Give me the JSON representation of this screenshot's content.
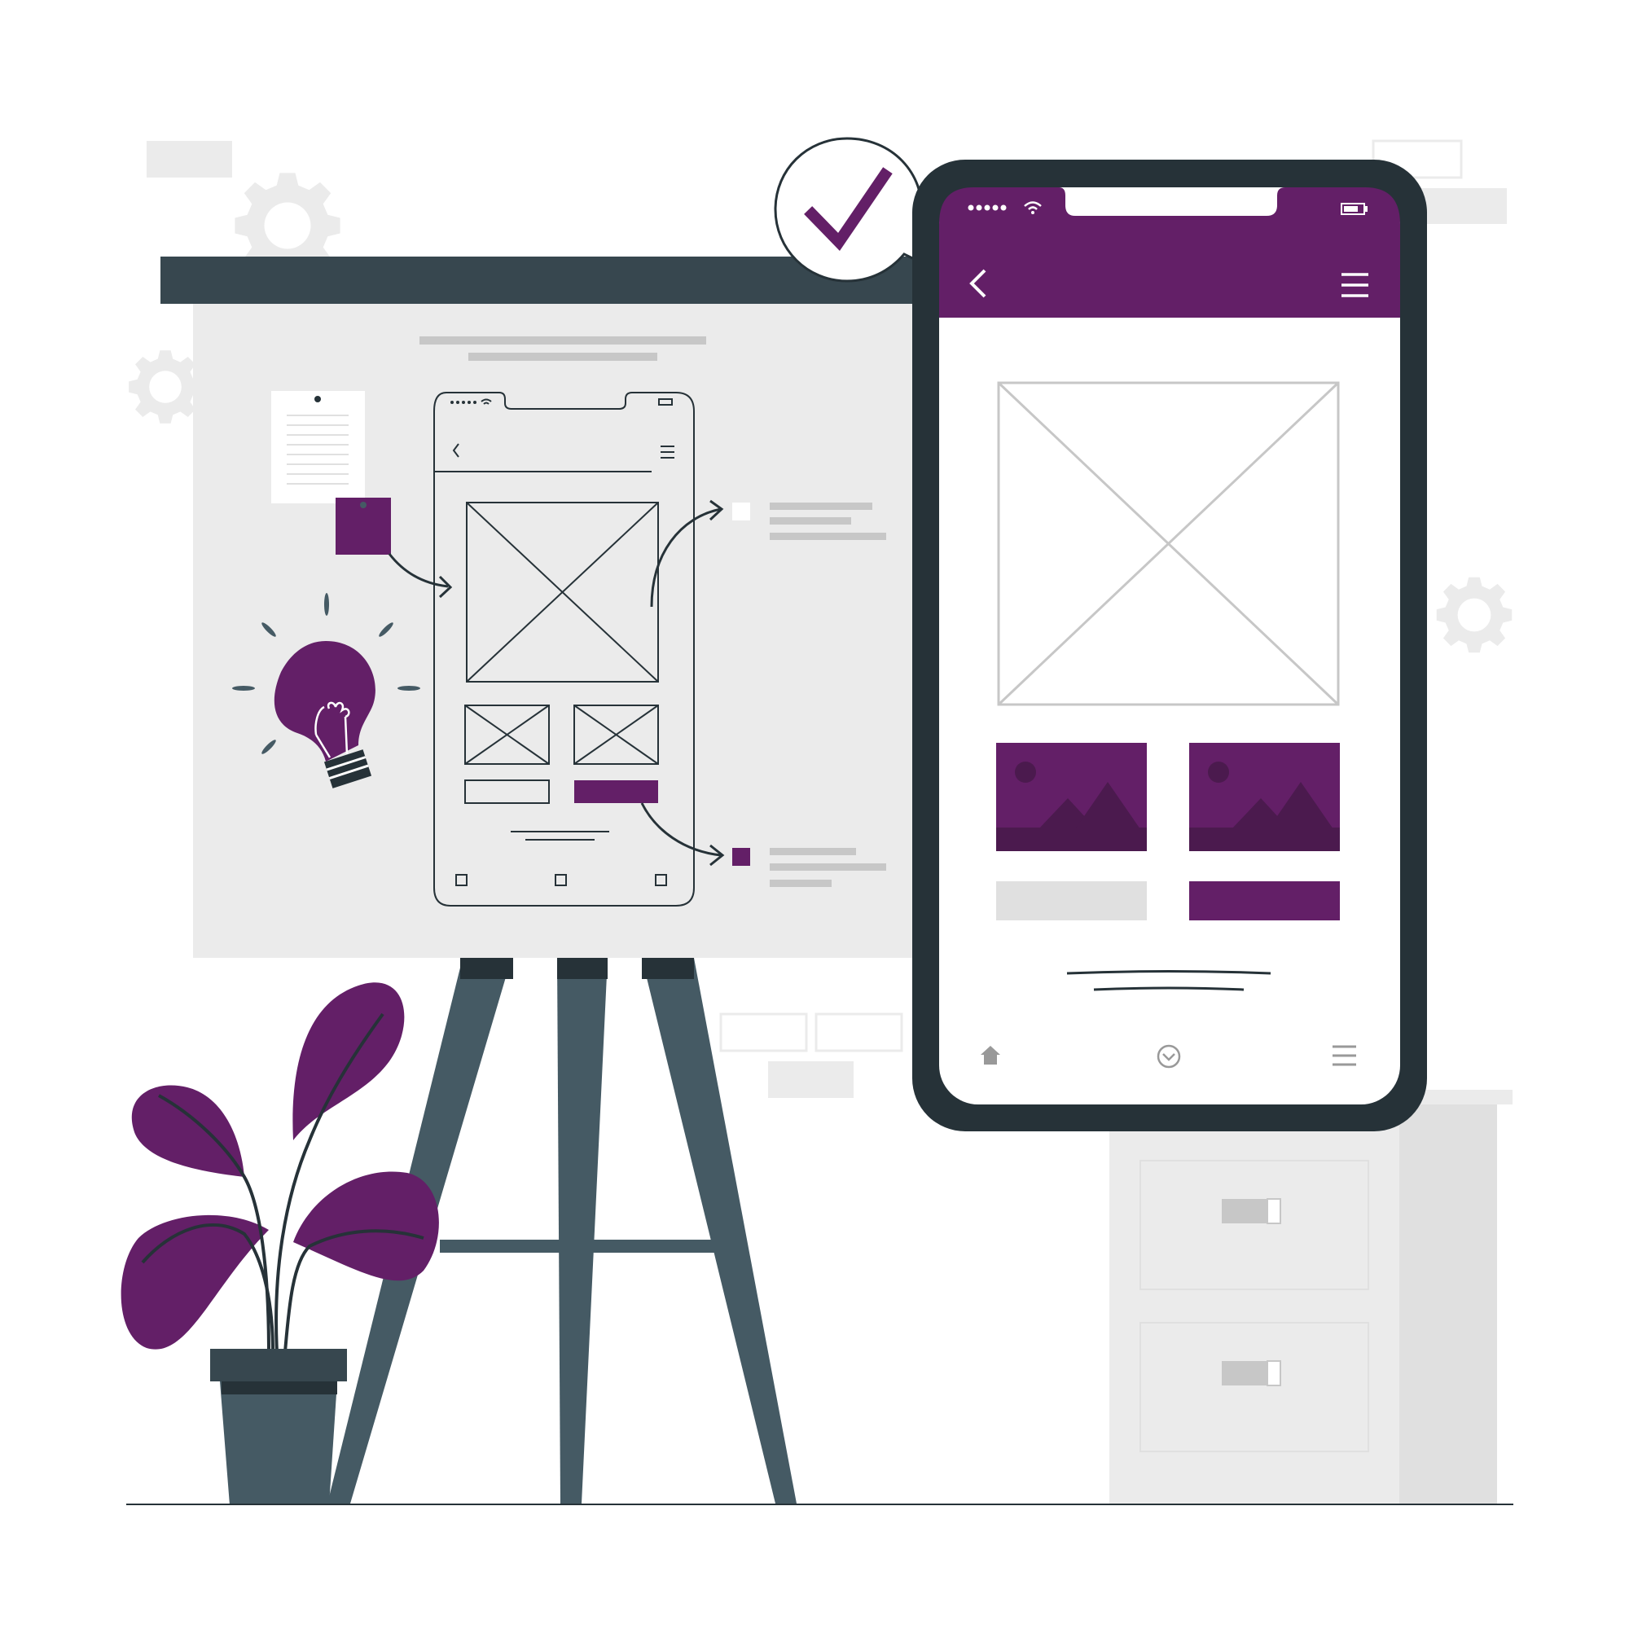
{
  "illustration": {
    "subject": "",
    "palette": {
      "accent": "#631f67",
      "accent_dark": "#4b1a4e",
      "dark": "#263238",
      "easel_steel": "#455a64",
      "board_gray": "#ebebeb",
      "light_gray": "#e0e0e0",
      "mid_gray": "#c7c7c7",
      "white": "#ffffff"
    },
    "icons": {
      "check": "checkmark-icon",
      "back": "chevron-left-icon",
      "menu": "hamburger-menu-icon",
      "home": "home-icon",
      "nav_center": "chevron-circle-icon",
      "list": "list-icon",
      "gear": "gear-icon",
      "bulb": "lightbulb-icon",
      "wifi": "wifi-icon",
      "battery": "battery-icon"
    },
    "phone": {
      "has_wireframe_image": true,
      "thumbnail_count": 2,
      "buttons": [
        "secondary",
        "primary"
      ]
    },
    "sketch": {
      "thumbnail_count": 2,
      "nav_icon_count": 3
    }
  }
}
